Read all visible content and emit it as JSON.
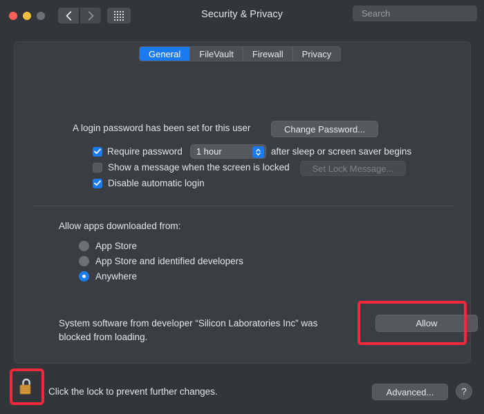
{
  "window": {
    "title": "Security & Privacy",
    "traffic_lights": [
      "close",
      "minimize",
      "zoom"
    ],
    "nav_back_icon": "chevron-left-icon",
    "nav_forward_icon": "chevron-right-icon",
    "grid_icon": "grid-apps-icon"
  },
  "search": {
    "placeholder": "Search",
    "value": "",
    "icon": "search-icon"
  },
  "tabs": [
    {
      "label": "General",
      "active": true
    },
    {
      "label": "FileVault",
      "active": false
    },
    {
      "label": "Firewall",
      "active": false
    },
    {
      "label": "Privacy",
      "active": false
    }
  ],
  "general": {
    "login_password_text": "A login password has been set for this user",
    "change_password_label": "Change Password...",
    "require_password_label": "Require password",
    "require_password_checked": true,
    "require_delay_value": "1 hour",
    "require_password_suffix": "after sleep or screen saver begins",
    "show_message_label": "Show a message when the screen is locked",
    "show_message_checked": false,
    "set_lock_message_label": "Set Lock Message...",
    "set_lock_message_disabled": true,
    "disable_auto_login_label": "Disable automatic login",
    "disable_auto_login_checked": true
  },
  "gatekeeper": {
    "heading": "Allow apps downloaded from:",
    "options": [
      {
        "label": "App Store",
        "selected": false
      },
      {
        "label": "App Store and identified developers",
        "selected": false
      },
      {
        "label": "Anywhere",
        "selected": true
      }
    ]
  },
  "blocked": {
    "message": "System software from developer “Silicon Laboratories Inc” was blocked from loading.",
    "allow_label": "Allow",
    "highlighted": true
  },
  "bottom": {
    "lock_icon": "padlock-open-icon",
    "lock_state": "unlocked",
    "lock_highlighted": true,
    "lock_caption": "Click the lock to prevent further changes.",
    "advanced_label": "Advanced...",
    "help_label": "?"
  },
  "colors": {
    "accent": "#1a7af0",
    "highlight": "#f4283c",
    "window_bg": "#323539",
    "panel_bg": "#3a3e42",
    "lock_body": "#d69a3c"
  }
}
